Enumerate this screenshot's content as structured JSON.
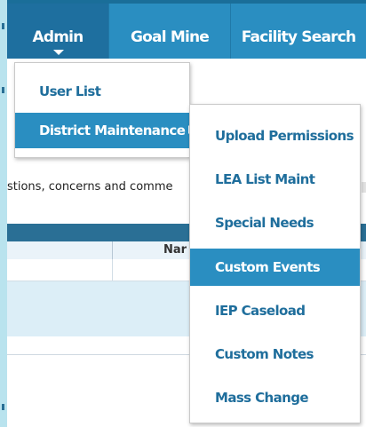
{
  "nav": {
    "items": [
      {
        "label": "Admin"
      },
      {
        "label": "Goal Mine"
      },
      {
        "label": "Facility Search"
      }
    ]
  },
  "admin_menu": {
    "items": [
      {
        "label": "User List"
      },
      {
        "label": "District Maintenance"
      }
    ]
  },
  "district_submenu": {
    "items": [
      {
        "label": "Upload Permissions"
      },
      {
        "label": "LEA List Maint"
      },
      {
        "label": "Special Needs"
      },
      {
        "label": "Custom Events"
      },
      {
        "label": "IEP Caseload"
      },
      {
        "label": "Custom Notes"
      },
      {
        "label": "Mass Change"
      }
    ]
  },
  "page": {
    "text_fragment": "stions, concerns and comme",
    "table_header_fragment": "Nar"
  },
  "colors": {
    "nav_bg": "#2a8ec1",
    "nav_active": "#1e6f9f",
    "menu_text": "#1f6e9c",
    "highlight": "#2a8ec1"
  },
  "icons": {
    "nav_caret": "caret-down-icon",
    "submenu_arrow": "caret-right-icon"
  }
}
